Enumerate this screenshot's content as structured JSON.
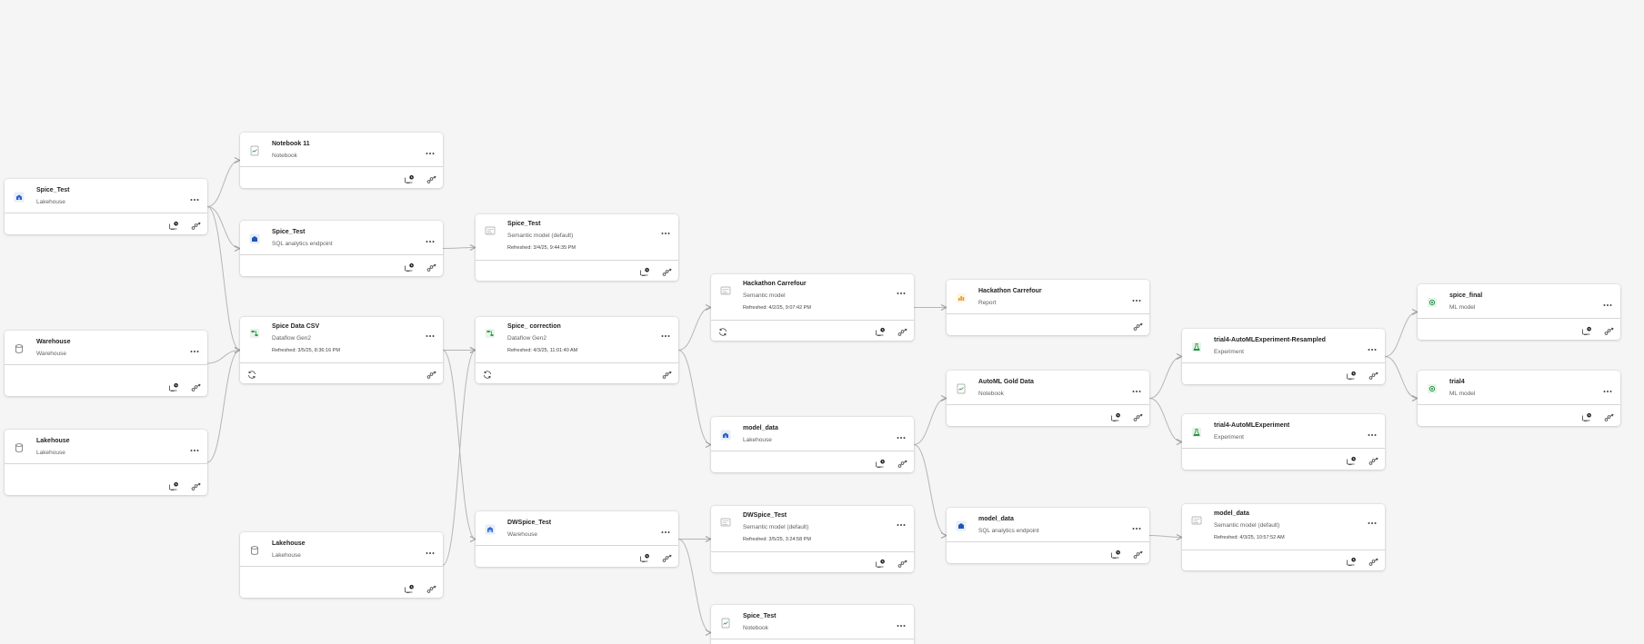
{
  "cards": [
    {
      "id": "c1",
      "title": "Spice_Test",
      "type": "Lakehouse",
      "refreshed": "",
      "icon": "lakehouse-icon",
      "monitor": true,
      "sync": false
    },
    {
      "id": "c2",
      "title": "Warehouse",
      "type": "Warehouse",
      "refreshed": "",
      "icon": "database-icon",
      "monitor": true,
      "sync": false
    },
    {
      "id": "c3",
      "title": "Lakehouse",
      "type": "Lakehouse",
      "refreshed": "",
      "icon": "database-icon",
      "monitor": true,
      "sync": false
    },
    {
      "id": "c4",
      "title": "Notebook 11",
      "type": "Notebook",
      "refreshed": "",
      "icon": "notebook-icon",
      "monitor": true,
      "sync": false
    },
    {
      "id": "c5",
      "title": "Spice_Test",
      "type": "SQL analytics endpoint",
      "refreshed": "",
      "icon": "sql-endpoint-icon",
      "monitor": true,
      "sync": false
    },
    {
      "id": "c6",
      "title": "Spice Data CSV",
      "type": "Dataflow Gen2",
      "refreshed": "Refreshed: 3/5/25, 8:36:16 PM",
      "icon": "dataflow-icon",
      "monitor": false,
      "sync": true
    },
    {
      "id": "c7",
      "title": "Lakehouse",
      "type": "Lakehouse",
      "refreshed": "",
      "icon": "database-icon",
      "monitor": true,
      "sync": false
    },
    {
      "id": "c8",
      "title": "Spice_Test",
      "type": "Semantic model (default)",
      "refreshed": "Refreshed: 3/4/25, 9:44:35 PM",
      "icon": "semantic-model-icon",
      "monitor": true,
      "sync": false
    },
    {
      "id": "c9",
      "title": "Spice_ correction",
      "type": "Dataflow Gen2",
      "refreshed": "Refreshed: 4/3/25, 11:01:40 AM",
      "icon": "dataflow-icon",
      "monitor": false,
      "sync": true
    },
    {
      "id": "c10",
      "title": "DWSpice_Test",
      "type": "Warehouse",
      "refreshed": "",
      "icon": "warehouse-icon",
      "monitor": true,
      "sync": false
    },
    {
      "id": "c11",
      "title": "Hackathon Carrefour",
      "type": "Semantic model",
      "refreshed": "Refreshed: 4/2/25, 9:07:42 PM",
      "icon": "semantic-model-icon",
      "monitor": true,
      "sync": true
    },
    {
      "id": "c12",
      "title": "model_data",
      "type": "Lakehouse",
      "refreshed": "",
      "icon": "lakehouse-icon",
      "monitor": true,
      "sync": false
    },
    {
      "id": "c13",
      "title": "DWSpice_Test",
      "type": "Semantic model (default)",
      "refreshed": "Refreshed: 3/5/25, 3:24:58 PM",
      "icon": "semantic-model-icon",
      "monitor": true,
      "sync": false
    },
    {
      "id": "c14",
      "title": "Spice_Test",
      "type": "Notebook",
      "refreshed": "",
      "icon": "notebook-icon",
      "monitor": true,
      "sync": false
    },
    {
      "id": "c15",
      "title": "Hackathon Carrefour",
      "type": "Report",
      "refreshed": "",
      "icon": "report-icon",
      "monitor": false,
      "sync": false
    },
    {
      "id": "c16",
      "title": "AutoML Gold Data",
      "type": "Notebook",
      "refreshed": "",
      "icon": "notebook-icon",
      "monitor": true,
      "sync": false
    },
    {
      "id": "c17",
      "title": "model_data",
      "type": "SQL analytics endpoint",
      "refreshed": "",
      "icon": "sql-endpoint-icon",
      "monitor": true,
      "sync": false
    },
    {
      "id": "c18",
      "title": "trial4-AutoMLExperiment-Resampled",
      "type": "Experiment",
      "refreshed": "",
      "icon": "experiment-icon",
      "monitor": true,
      "sync": false
    },
    {
      "id": "c19",
      "title": "trial4-AutoMLExperiment",
      "type": "Experiment",
      "refreshed": "",
      "icon": "experiment-icon",
      "monitor": true,
      "sync": false
    },
    {
      "id": "c20",
      "title": "model_data",
      "type": "Semantic model (default)",
      "refreshed": "Refreshed: 4/3/25, 10:57:52 AM",
      "icon": "semantic-model-icon",
      "monitor": true,
      "sync": false
    },
    {
      "id": "c21",
      "title": "spice_final",
      "type": "ML model",
      "refreshed": "",
      "icon": "ml-model-icon",
      "monitor": true,
      "sync": false
    },
    {
      "id": "c22",
      "title": "trial4",
      "type": "ML model",
      "refreshed": "",
      "icon": "ml-model-icon",
      "monitor": true,
      "sync": false
    }
  ],
  "edges": [
    [
      "c1",
      "c4"
    ],
    [
      "c1",
      "c5"
    ],
    [
      "c1",
      "c6"
    ],
    [
      "c2",
      "c6"
    ],
    [
      "c3",
      "c6"
    ],
    [
      "c5",
      "c8"
    ],
    [
      "c6",
      "c9"
    ],
    [
      "c6",
      "c10"
    ],
    [
      "c7",
      "c9"
    ],
    [
      "c9",
      "c11"
    ],
    [
      "c9",
      "c12"
    ],
    [
      "c10",
      "c13"
    ],
    [
      "c10",
      "c14"
    ],
    [
      "c11",
      "c15"
    ],
    [
      "c12",
      "c16"
    ],
    [
      "c12",
      "c17"
    ],
    [
      "c16",
      "c18"
    ],
    [
      "c16",
      "c19"
    ],
    [
      "c17",
      "c20"
    ],
    [
      "c18",
      "c21"
    ],
    [
      "c18",
      "c22"
    ]
  ]
}
